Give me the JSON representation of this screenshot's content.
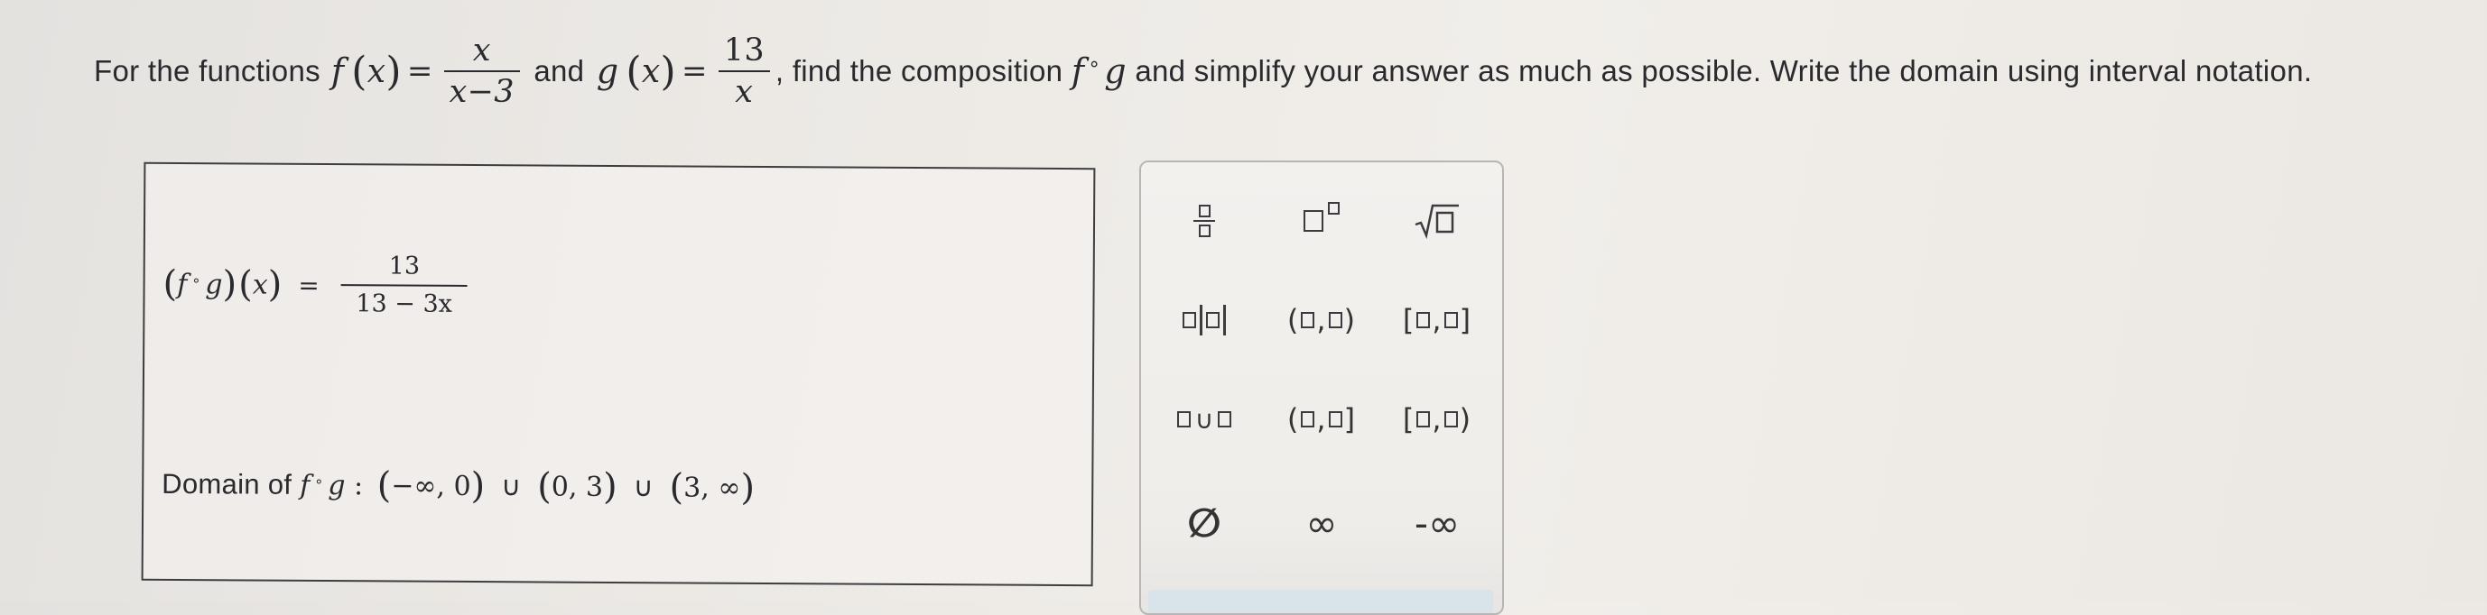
{
  "question": {
    "intro": "For the functions ",
    "f_name": "f",
    "x_var": "x",
    "f_num": "x",
    "f_den": "x−3",
    "and": " and ",
    "g_name": "g",
    "g_num": "13",
    "g_den": "x",
    "mid": ", find the composition ",
    "comp_dot": "∘",
    "tail": " and simplify your answer as much as possible. Write the domain using interval notation."
  },
  "answer": {
    "composition_lhs_f": "f",
    "composition_lhs_g": "g",
    "composition_x": "x",
    "equals": "=",
    "result_num": "13",
    "result_den": "13 − 3x",
    "domain_label": "Domain of ",
    "domain_f": "f",
    "domain_g": "g",
    "domain_colon": " : ",
    "interval_1_a": "−∞",
    "interval_1_b": "0",
    "interval_2_a": "0",
    "interval_2_b": "3",
    "interval_3_a": "3",
    "interval_3_b": "∞",
    "comma": ", ",
    "union": "∪"
  },
  "keypad": {
    "empty_set": "∅",
    "infinity": "∞",
    "neg_infinity": "-∞",
    "open_open": "(□,□)",
    "closed_closed": "[□,□]",
    "open_closed": "(□,□]",
    "closed_open": "[□,□)"
  }
}
